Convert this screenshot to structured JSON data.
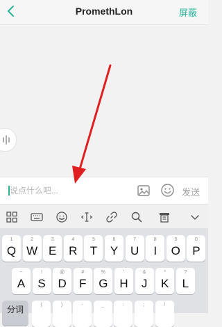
{
  "header": {
    "title": "PromethLon",
    "block_label": "屏蔽"
  },
  "composer": {
    "placeholder": "说点什么吧...",
    "send_label": "发送"
  },
  "keyboard": {
    "row1": [
      {
        "key": "Q",
        "sub": "1"
      },
      {
        "key": "W",
        "sub": "2"
      },
      {
        "key": "E",
        "sub": "3"
      },
      {
        "key": "R",
        "sub": "4"
      },
      {
        "key": "T",
        "sub": "5"
      },
      {
        "key": "Y",
        "sub": "6"
      },
      {
        "key": "U",
        "sub": "7"
      },
      {
        "key": "I",
        "sub": "8"
      },
      {
        "key": "O",
        "sub": "9"
      },
      {
        "key": "P",
        "sub": "0"
      }
    ],
    "row2": [
      {
        "key": "A",
        "sub": "~"
      },
      {
        "key": "S",
        "sub": "!"
      },
      {
        "key": "D",
        "sub": "@"
      },
      {
        "key": "F",
        "sub": "#"
      },
      {
        "key": "G",
        "sub": "%"
      },
      {
        "key": "H",
        "sub": "'"
      },
      {
        "key": "J",
        "sub": "&"
      },
      {
        "key": "K",
        "sub": "*"
      },
      {
        "key": "L",
        "sub": "?"
      }
    ],
    "row3": [
      {
        "key": "",
        "sub": "("
      },
      {
        "key": "",
        "sub": ")"
      },
      {
        "key": "",
        "sub": "-"
      },
      {
        "key": "",
        "sub": "_"
      },
      {
        "key": "",
        "sub": ":"
      },
      {
        "key": "",
        "sub": ";"
      },
      {
        "key": "",
        "sub": "/"
      }
    ],
    "segment_label": "分词"
  },
  "colors": {
    "accent": "#2bb39a",
    "annotation_arrow": "#e02020"
  }
}
